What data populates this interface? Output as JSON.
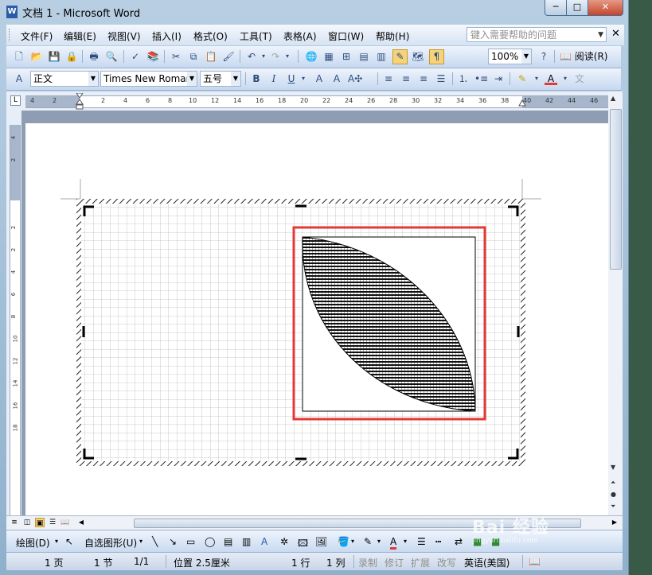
{
  "window": {
    "title": "文档 1 - Microsoft Word",
    "app_icon": "word-icon",
    "min_label": "─",
    "max_label": "□",
    "close_label": "✕"
  },
  "menubar": {
    "items": [
      "文件(F)",
      "编辑(E)",
      "视图(V)",
      "插入(I)",
      "格式(O)",
      "工具(T)",
      "表格(A)",
      "窗口(W)",
      "帮助(H)"
    ],
    "help_placeholder": "键入需要帮助的问题",
    "close_doc_label": "✕"
  },
  "standard_toolbar": {
    "zoom": "100%",
    "read_label": "阅读(R)"
  },
  "format_toolbar": {
    "style": "正文",
    "font": "Times New Roman",
    "size": "五号",
    "bold": "B",
    "italic": "I",
    "underline": "U"
  },
  "ruler": {
    "h_ticks": [
      "4",
      "2",
      "2",
      "4",
      "6",
      "8",
      "10",
      "12",
      "14",
      "16",
      "18",
      "20",
      "22",
      "24",
      "26",
      "28",
      "30",
      "32",
      "34",
      "36",
      "38",
      "40",
      "42",
      "44",
      "46"
    ],
    "v_ticks": [
      "4",
      "2",
      "2",
      "2",
      "4",
      "6",
      "8",
      "10",
      "12",
      "14",
      "16",
      "18"
    ]
  },
  "drawing_toolbar": {
    "draw_label": "绘图(D)",
    "autoshape_label": "自选图形(U)"
  },
  "statusbar": {
    "page": "1 页",
    "section": "1 节",
    "page_of": "1/1",
    "position": "位置 2.5厘米",
    "line": "1 行",
    "column": "1 列",
    "rec": "录制",
    "trk": "修订",
    "ext": "扩展",
    "ovr": "改写",
    "language": "英语(美国)"
  },
  "drawing": {
    "shape_fill": "horizontal-stripes",
    "highlight_color": "#e53935"
  },
  "watermark": {
    "brand": "Bai 经验",
    "url": "jingyan.baidu.com"
  }
}
